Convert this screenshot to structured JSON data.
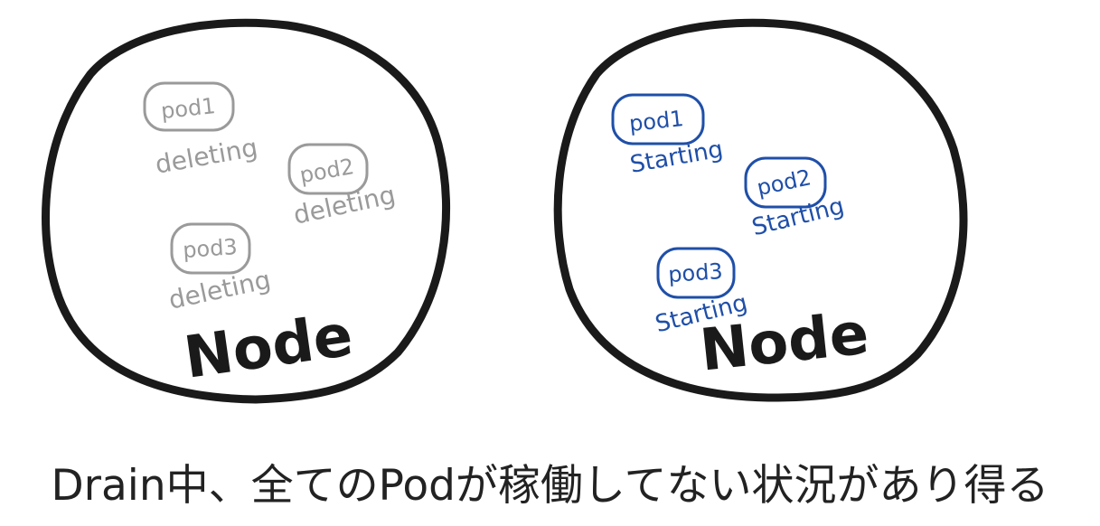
{
  "colors": {
    "outline": "#1a1a1a",
    "deleting": "#9a9a9a",
    "starting": "#1f4fa8",
    "caption": "#222222"
  },
  "nodes": [
    {
      "label": "Node",
      "status_color": "#9a9a9a",
      "pods": [
        {
          "name": "pod1",
          "status": "deleting"
        },
        {
          "name": "pod2",
          "status": "deleting"
        },
        {
          "name": "pod3",
          "status": "deleting"
        }
      ]
    },
    {
      "label": "Node",
      "status_color": "#1f4fa8",
      "pods": [
        {
          "name": "pod1",
          "status": "Starting"
        },
        {
          "name": "pod2",
          "status": "Starting"
        },
        {
          "name": "pod3",
          "status": "Starting"
        }
      ]
    }
  ],
  "caption": "Drain中、全てのPodが稼働してない状況があり得る"
}
